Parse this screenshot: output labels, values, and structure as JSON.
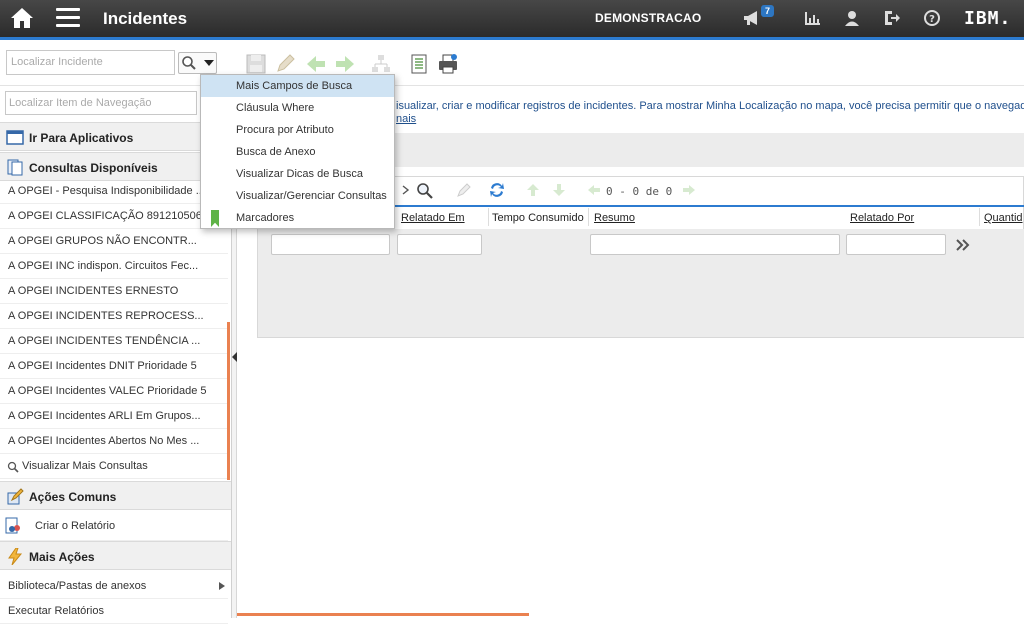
{
  "header": {
    "title": "Incidentes",
    "user": "DEMONSTRACAO",
    "notification_count": "7",
    "brand": "IBM."
  },
  "toolbar": {
    "search_placeholder": "Localizar Incidente"
  },
  "dropdown": {
    "items": [
      "Mais Campos de Busca",
      "Cláusula Where",
      "Procura por Atributo",
      "Busca de Anexo",
      "Visualizar Dicas de Busca",
      "Visualizar/Gerenciar Consultas",
      "Marcadores"
    ]
  },
  "sidebar": {
    "nav_search_placeholder": "Localizar Item de Navegação",
    "go_to_apps": "Ir Para Aplicativos",
    "available_queries": "Consultas Disponíveis",
    "queries": [
      "A OPGEI - Pesquisa Indisponibilidade ...",
      "A OPGEI CLASSIFICAÇÃO 891210506",
      "A OPGEI GRUPOS NÃO ENCONTR...",
      "A OPGEI INC indispon. Circuitos Fec...",
      "A OPGEI INCIDENTES ERNESTO",
      "A OPGEI INCIDENTES REPROCESS...",
      "A OPGEI INCIDENTES TENDÊNCIA ...",
      "A OPGEI Incidentes DNIT Prioridade 5",
      "A OPGEI Incidentes VALEC Prioridade 5",
      "A OPGEI Incidentes ARLI Em Grupos...",
      "A OPGEI Incidentes Abertos No Mes ..."
    ],
    "more_queries": "Visualizar Mais Consultas",
    "common_actions": "Ações Comuns",
    "create_report": "Criar o Relatório",
    "more_actions": "Mais Ações",
    "attachments_library": "Biblioteca/Pastas de anexos",
    "run_reports": "Executar Relatórios"
  },
  "main": {
    "message": "isualizar, criar e modificar registros de incidentes. Para mostrar Minha Localização no mapa, você precisa permitir que o navegad",
    "message_link": "nais",
    "pager": "0 - 0 de 0",
    "columns": [
      "Relatado Em",
      "Tempo Consumido",
      "Resumo",
      "Relatado Por",
      "Quantid"
    ]
  }
}
